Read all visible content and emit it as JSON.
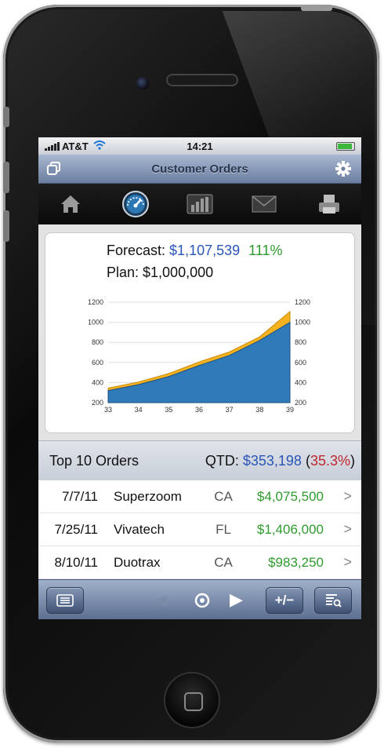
{
  "status": {
    "carrier": "AT&T",
    "time": "14:21"
  },
  "nav": {
    "title": "Customer Orders"
  },
  "tabs": [
    {
      "icon": "home-icon"
    },
    {
      "icon": "dashboard-gauge-icon"
    },
    {
      "icon": "bar-chart-icon"
    },
    {
      "icon": "mail-icon"
    },
    {
      "icon": "printer-icon"
    }
  ],
  "forecast": {
    "label": "Forecast:",
    "amount": "$1,107,539",
    "pct": "111%"
  },
  "plan": {
    "text": "Plan: $1,000,000"
  },
  "chart_data": {
    "type": "area",
    "x": [
      33,
      34,
      35,
      36,
      37,
      38,
      39
    ],
    "series": [
      {
        "values": [
          320,
          380,
          460,
          570,
          670,
          820,
          1000
        ],
        "color": "#2f7ab8"
      },
      {
        "values": [
          345,
          405,
          490,
          605,
          705,
          855,
          1107
        ],
        "color": "#f5b21e"
      }
    ],
    "xticks": [
      "33",
      "34",
      "35",
      "36",
      "37",
      "38",
      "39"
    ],
    "yticks": [
      "200",
      "400",
      "600",
      "800",
      "1000",
      "1200"
    ],
    "ylim": [
      200,
      1200
    ],
    "grid": true
  },
  "summary": {
    "label": "Top 10 Orders",
    "qtd_label": "QTD:",
    "qtd_value": "$353,198",
    "pct_open": "(",
    "pct": "35.3%",
    "pct_close": ")"
  },
  "orders": [
    {
      "date": "7/7/11",
      "company": "Superzoom",
      "state": "CA",
      "amount": "$4,075,500",
      "chev": ">"
    },
    {
      "date": "7/25/11",
      "company": "Vivatech",
      "state": "FL",
      "amount": "$1,406,000",
      "chev": ">"
    },
    {
      "date": "8/10/11",
      "company": "Duotrax",
      "state": "CA",
      "amount": "$983,250",
      "chev": ">"
    }
  ],
  "toolbar": {
    "prev": "◀",
    "next": "▶",
    "stepper": "+/−"
  },
  "colors": {
    "accent_blue": "#2a55b8",
    "positive_green": "#2e9a2e",
    "negative_red": "#c0262d"
  }
}
